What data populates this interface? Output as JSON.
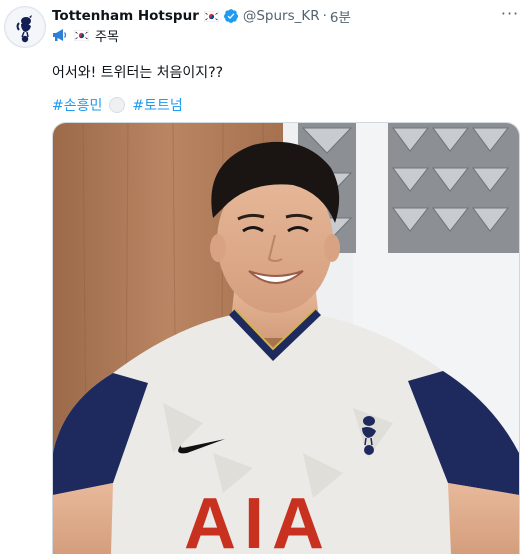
{
  "tweet": {
    "author_name": "Tottenham Hotspur",
    "author_handle": "@Spurs_KR",
    "separator": "·",
    "timestamp": "6분",
    "pinned_label": "주목",
    "text": "어서와! 트위터는 처음이지??",
    "hashtags": [
      "#손흥민",
      "#토트넘"
    ],
    "more_label": "···"
  },
  "media": {
    "jersey_text": "AIA"
  },
  "colors": {
    "link": "#1d9bf0",
    "verified": "#1d9bf0",
    "muted": "#536471"
  },
  "icons": {
    "avatar": "spurs-cockerel-icon",
    "verified": "verified-badge-icon",
    "flag": "south-korea-flag-icon",
    "megaphone": "megaphone-icon",
    "more": "more-options-icon"
  }
}
